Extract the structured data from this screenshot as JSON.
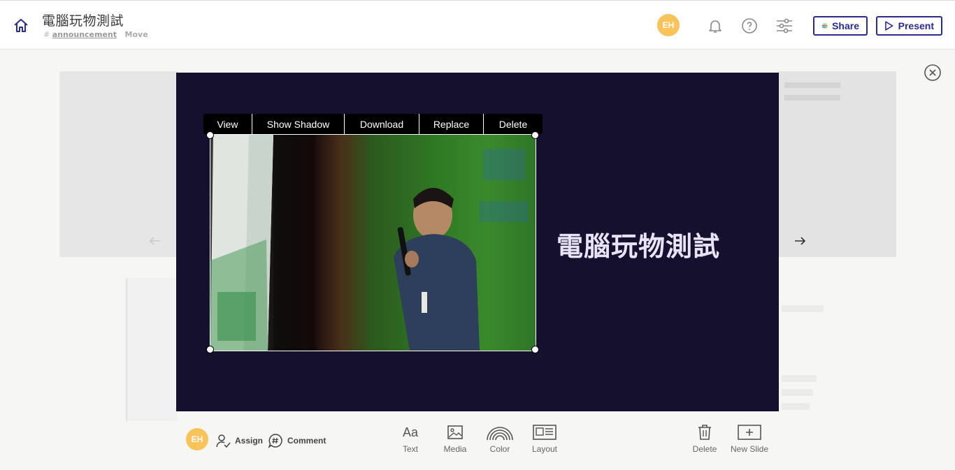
{
  "header": {
    "title": "電腦玩物測試",
    "hash": "#",
    "channel": "announcement",
    "move_label": "Move",
    "avatar_initials": "EH",
    "share_label": "Share",
    "present_label": "Present"
  },
  "image_toolbar": {
    "items": [
      "View",
      "Show Shadow",
      "Download",
      "Replace",
      "Delete"
    ]
  },
  "slide": {
    "title": "電腦玩物測試",
    "background_color": "#16102f"
  },
  "bottom": {
    "avatar_initials": "EH",
    "assign_label": "Assign",
    "comment_label": "Comment",
    "text_glyph": "Aa",
    "text_label": "Text",
    "media_label": "Media",
    "color_label": "Color",
    "layout_label": "Layout",
    "delete_label": "Delete",
    "new_slide_label": "New Slide"
  },
  "colors": {
    "accent": "#2b2a8f",
    "avatar": "#f7c35a"
  }
}
